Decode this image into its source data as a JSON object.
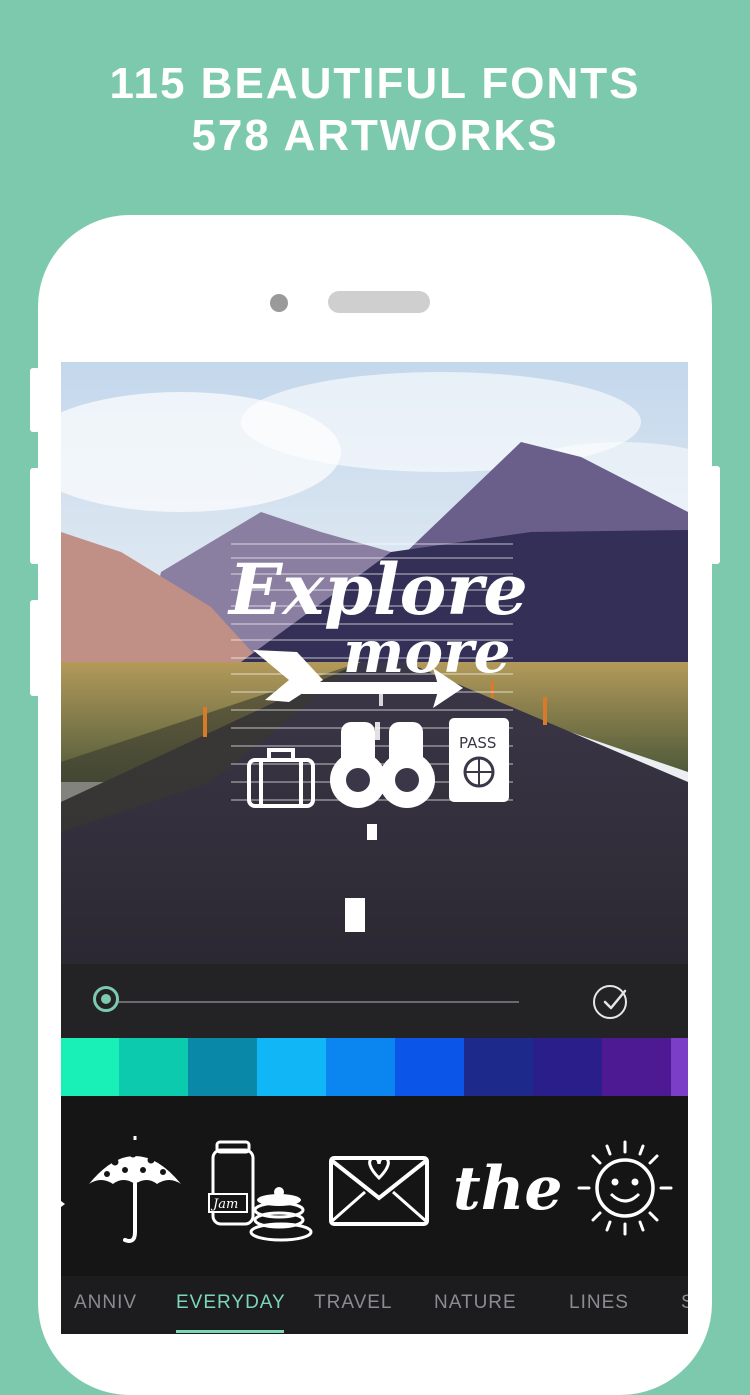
{
  "headline": {
    "line1": "115 BEAUTIFUL FONTS",
    "line2": "578 ARTWORKS"
  },
  "artwork_text": {
    "line1": "Explore",
    "line2": "more",
    "passport_label": "PASS"
  },
  "editor": {
    "slider_value": 0.0,
    "confirm_icon": "check-circle-icon"
  },
  "swatches": [
    "#19f0b8",
    "#0ccaae",
    "#0a88a8",
    "#10b6f6",
    "#0b86f0",
    "#0b56e8",
    "#1d2a8c",
    "#2a1f8a",
    "#4e1a94",
    "#7a3fc6"
  ],
  "artworks": [
    {
      "icon": "umbrella-icon"
    },
    {
      "icon": "jam-pancakes-icon",
      "label": "Jam"
    },
    {
      "icon": "envelope-heart-icon"
    },
    {
      "icon": "the-script-icon",
      "label": "the"
    },
    {
      "icon": "smiling-sun-icon"
    }
  ],
  "tabs": [
    {
      "label": "ANNIV",
      "active": false
    },
    {
      "label": "EVERYDAY",
      "active": true
    },
    {
      "label": "TRAVEL",
      "active": false
    },
    {
      "label": "NATURE",
      "active": false
    },
    {
      "label": "LINES",
      "active": false
    },
    {
      "label": "S",
      "active": false
    }
  ]
}
